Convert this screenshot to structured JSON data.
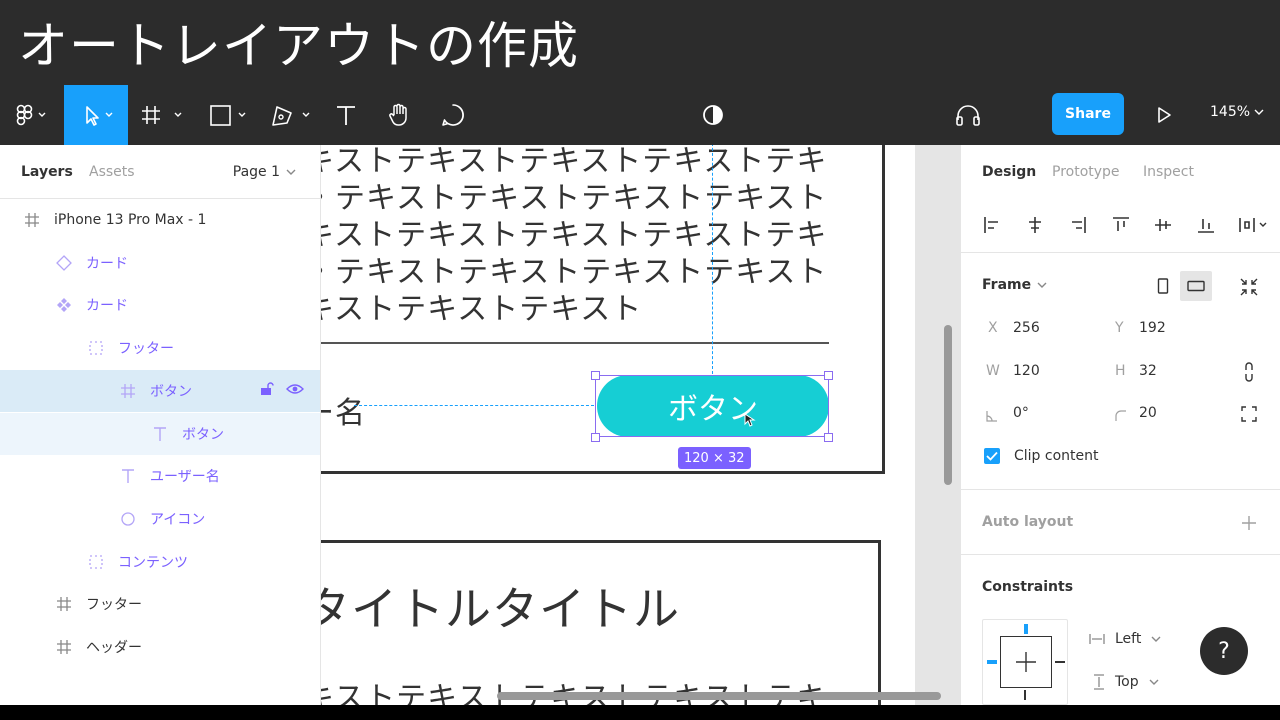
{
  "banner": {
    "title": "オートレイアウトの作成"
  },
  "toolbar": {
    "share_label": "Share",
    "zoom_label": "145%",
    "tools": [
      "figma-menu-icon",
      "move-tool-icon",
      "frame-tool-icon",
      "shape-tool-icon",
      "pen-tool-icon",
      "text-tool-icon",
      "hand-tool-icon",
      "comment-tool-icon"
    ],
    "accent": "#18a0fb"
  },
  "left_panel": {
    "tabs": [
      "Layers",
      "Assets"
    ],
    "page_label": "Page 1",
    "layers": [
      {
        "name": "iPhone 13 Pro Max - 1",
        "icon": "frame-icon",
        "indent": 0,
        "style": "frame"
      },
      {
        "name": "カード",
        "icon": "instance-icon",
        "indent": 1,
        "style": "component"
      },
      {
        "name": "カード",
        "icon": "component-icon",
        "indent": 1,
        "style": "component"
      },
      {
        "name": "フッター",
        "icon": "autolayout-icon",
        "indent": 2,
        "style": "component"
      },
      {
        "name": "ボタン",
        "icon": "frame-icon",
        "indent": 3,
        "style": "component",
        "selected": true
      },
      {
        "name": "ボタン",
        "icon": "text-icon",
        "indent": 4,
        "style": "component",
        "child_selected": true
      },
      {
        "name": "ユーザー名",
        "icon": "text-icon",
        "indent": 3,
        "style": "component"
      },
      {
        "name": "アイコン",
        "icon": "ellipse-icon",
        "indent": 3,
        "style": "component"
      },
      {
        "name": "コンテンツ",
        "icon": "autolayout-icon",
        "indent": 2,
        "style": "component"
      },
      {
        "name": "フッター",
        "icon": "frame-icon",
        "indent": 1,
        "style": "frame"
      },
      {
        "name": "ヘッダー",
        "icon": "frame-icon",
        "indent": 1,
        "style": "frame"
      }
    ]
  },
  "canvas": {
    "text_lines": [
      "キストテキストテキストテキストテキ",
      "・テキストテキストテキストテキスト",
      "キストテキストテキストテキストテキ",
      "・テキストテキストテキストテキスト",
      "キストテキストテキスト"
    ],
    "user_name_fragment": "ー名",
    "button_label": "ボタン",
    "dimension_badge": "120 × 32",
    "card2_title": "タイトルタイトル",
    "card2_text": "キストテキストテキストテキストテキ",
    "button_color": "#16ced4",
    "selection_color": "#7b61ff"
  },
  "right_panel": {
    "tabs": [
      "Design",
      "Prototype",
      "Inspect"
    ],
    "frame_label": "Frame",
    "x_label": "X",
    "x_value": "256",
    "y_label": "Y",
    "y_value": "192",
    "w_label": "W",
    "w_value": "120",
    "h_label": "H",
    "h_value": "32",
    "rotation_value": "0°",
    "radius_value": "20",
    "clip_content_label": "Clip content",
    "auto_layout_label": "Auto layout",
    "constraints_label": "Constraints",
    "constraint_h": "Left",
    "constraint_v": "Top"
  },
  "help_label": "?"
}
